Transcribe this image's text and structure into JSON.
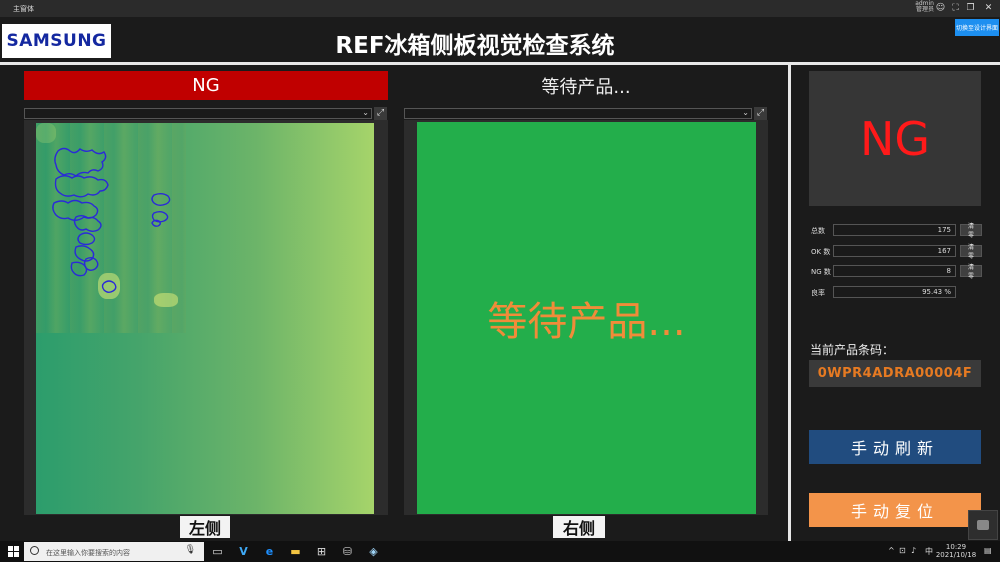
{
  "window": {
    "title": "主窗体",
    "user_name": "admin",
    "user_role": "管理员"
  },
  "header": {
    "logo_text": "SAMSUNG",
    "title": "REF冰箱侧板视觉检查系统",
    "design_button": "切换至设计界面"
  },
  "left_panel": {
    "status": "NG",
    "label": "左侧"
  },
  "right_panel": {
    "status": "等待产品...",
    "overlay": "等待产品...",
    "label": "右侧"
  },
  "result": {
    "text": "NG",
    "color": "#ff1a1a"
  },
  "stats": [
    {
      "label": "总数",
      "value": "175",
      "clear": "清零"
    },
    {
      "label": "OK 数",
      "value": "167",
      "clear": "清零"
    },
    {
      "label": "NG 数",
      "value": "8",
      "clear": "清零"
    },
    {
      "label": "良率",
      "value": "95.43 %"
    }
  ],
  "barcode": {
    "label": "当前产品条码：",
    "value": "0WPR4ADRA00004F"
  },
  "buttons": {
    "refresh": "手动刷新",
    "reset": "手动复位"
  },
  "taskbar": {
    "search_placeholder": "在这里输入你要搜索的内容",
    "ime": "中",
    "time": "10:29",
    "date": "2021/10/18"
  },
  "colors": {
    "ng_red": "#c00000",
    "wait_green": "#23ae4b",
    "wait_text": "#f08c39",
    "refresh_blue": "#214c7f",
    "reset_orange": "#f3944a",
    "barcode_orange": "#e67a22"
  }
}
